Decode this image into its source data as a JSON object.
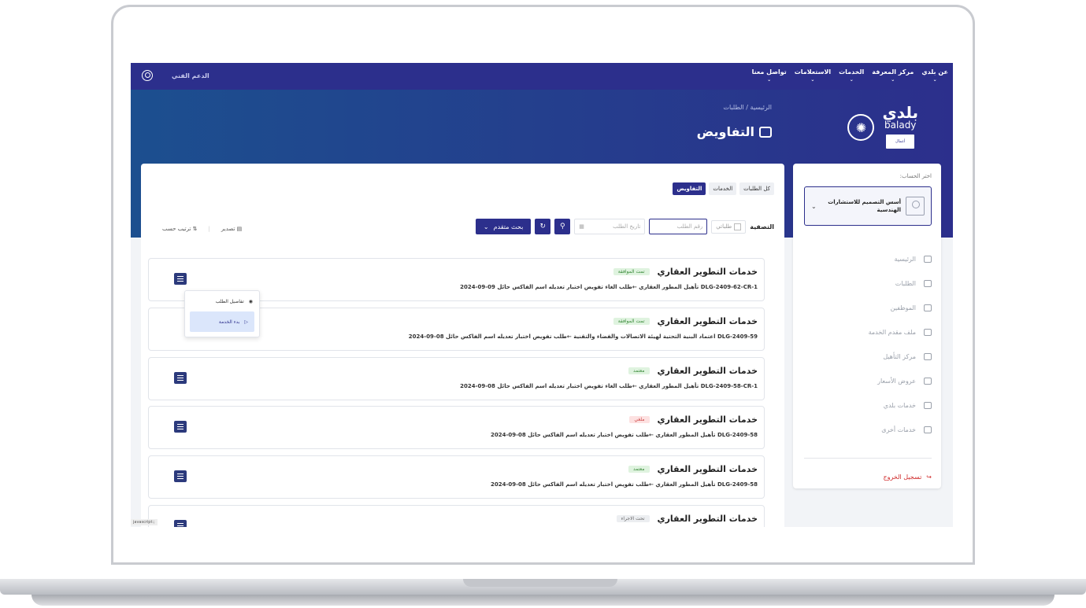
{
  "topnav": {
    "items": [
      {
        "label": "عن بلدي"
      },
      {
        "label": "مركز المعرفة"
      },
      {
        "label": "الخدمات"
      },
      {
        "label": "الاستعلامات"
      },
      {
        "label": "تواصل معنا"
      }
    ],
    "support_label": "الدعم الفني"
  },
  "brand": {
    "ar": "بلدي",
    "en": "balady",
    "tag": "أعمال"
  },
  "breadcrumb": "الرئيسية / الطلبات",
  "page_title": "التفاويض",
  "account": {
    "label": "اختر الحساب:",
    "name": "أسس التصميم للاستشارات الهندسية"
  },
  "sidebar": {
    "items": [
      {
        "label": "الرئيسية"
      },
      {
        "label": "الطلبات"
      },
      {
        "label": "الموظفين"
      },
      {
        "label": "ملف مقدم الخدمة"
      },
      {
        "label": "مركز التأهيل"
      },
      {
        "label": "عروض الأسعار"
      },
      {
        "label": "خدمات بلدي"
      },
      {
        "label": "خدمات أخرى"
      }
    ],
    "logout": "تسجيل الخروج"
  },
  "tabs": [
    {
      "label": "كل الطلبات"
    },
    {
      "label": "الخدمات"
    },
    {
      "label": "التفاويض"
    }
  ],
  "filter": {
    "label": "التصفية",
    "check_label": "طلباتي",
    "req_placeholder": "رقم الطلب",
    "date_placeholder": "تاريخ الطلب",
    "advanced": "بحث متقدم"
  },
  "tools": {
    "export": "تصدير",
    "sort": "ترتيب حسب"
  },
  "cards": [
    {
      "title": "خدمات التطوير العقاري",
      "status": "تمت الموافقة",
      "meta": "DLG-2409-62-CR-1  تأهيل المطور العقاري  ←طلب الغاء تفويض  اختبار تعديله اسم الفاكس  حائل  09-09-2024"
    },
    {
      "title": "خدمات التطوير العقاري",
      "status": "تمت الموافقة",
      "meta": "DLG-2409-59  اعتماد البنية التحتية لهيئة الاتصالات والفضاء والتقنية  ←طلب تفويض  اختبار تعديله اسم الفاكس  حائل  08-09-2024"
    },
    {
      "title": "خدمات التطوير العقاري",
      "status": "معتمد",
      "meta": "DLG-2409-58-CR-1  تأهيل المطور العقاري  ←طلب الغاء تفويض  اختبار تعديله اسم الفاكس  حائل  08-09-2024"
    },
    {
      "title": "خدمات التطوير العقاري",
      "status": "ملغي",
      "meta": "DLG-2409-58  تأهيل المطور العقاري  ←طلب تفويض  اختبار تعديله اسم الفاكس  حائل  08-09-2024"
    },
    {
      "title": "خدمات التطوير العقاري",
      "status": "معتمد",
      "meta": "DLG-2409-58  تأهيل المطور العقاري  ←طلب تفويض  اختبار تعديله اسم الفاكس  حائل  08-09-2024"
    },
    {
      "title": "خدمات التطوير العقاري",
      "status": "تحت الاجراء",
      "meta": ""
    }
  ],
  "popup": {
    "details": "تفاصيل الطلب",
    "start": "بدء الخدمة"
  },
  "statusbar": "javascript:;"
}
